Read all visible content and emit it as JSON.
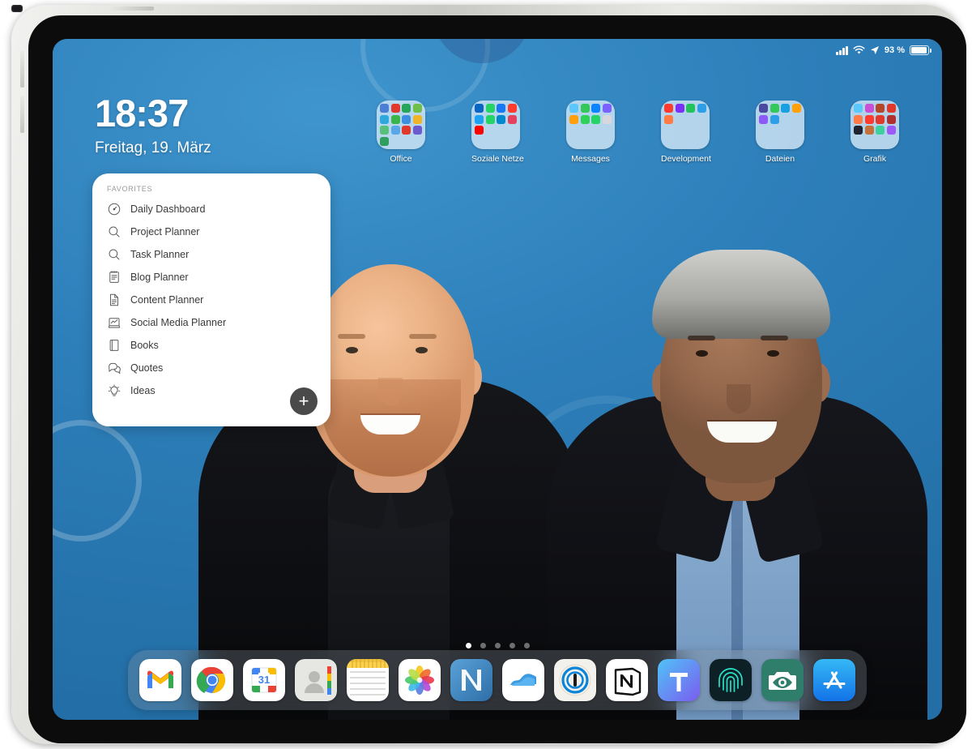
{
  "device": {
    "name": "iPad Pro"
  },
  "status_bar": {
    "signal_icon": "cellular-signal-icon",
    "wifi_icon": "wifi-icon",
    "location_icon": "location-arrow-icon",
    "battery_percent": "93 %",
    "battery_icon": "battery-icon"
  },
  "clock": {
    "time": "18:37",
    "date": "Freitag, 19. März"
  },
  "folders": [
    {
      "label": "Office",
      "count": 13
    },
    {
      "label": "Soziale Netze",
      "count": 9
    },
    {
      "label": "Messages",
      "count": 8
    },
    {
      "label": "Development",
      "count": 5
    },
    {
      "label": "Dateien",
      "count": 6
    },
    {
      "label": "Grafik",
      "count": 12
    }
  ],
  "favorites_widget": {
    "title": "FAVORITES",
    "add_button_label": "+",
    "items": [
      {
        "label": "Daily Dashboard",
        "icon": "gauge-icon"
      },
      {
        "label": "Project Planner",
        "icon": "magnifier-icon"
      },
      {
        "label": "Task Planner",
        "icon": "magnifier-icon"
      },
      {
        "label": "Blog Planner",
        "icon": "notepad-icon"
      },
      {
        "label": "Content Planner",
        "icon": "document-icon"
      },
      {
        "label": "Social Media Planner",
        "icon": "chart-board-icon"
      },
      {
        "label": "Books",
        "icon": "book-icon"
      },
      {
        "label": "Quotes",
        "icon": "speech-bubbles-icon"
      },
      {
        "label": "Ideas",
        "icon": "lightbulb-icon"
      }
    ]
  },
  "page_dots": {
    "total": 5,
    "active_index": 0
  },
  "dock": {
    "apps": [
      {
        "name": "Gmail",
        "icon": "gmail-icon"
      },
      {
        "name": "Chrome",
        "icon": "chrome-icon"
      },
      {
        "name": "Google Calendar",
        "icon": "google-calendar-icon",
        "day": "31"
      },
      {
        "name": "Google Contacts",
        "icon": "contacts-icon"
      },
      {
        "name": "Notes",
        "icon": "notes-icon"
      },
      {
        "name": "Photos",
        "icon": "photos-icon"
      },
      {
        "name": "Notability",
        "icon": "notability-icon"
      },
      {
        "name": "MindNode",
        "icon": "mindnode-icon"
      },
      {
        "name": "1Password",
        "icon": "onepassword-icon"
      },
      {
        "name": "Notion",
        "icon": "notion-icon"
      },
      {
        "name": "Textastic",
        "icon": "textastic-icon"
      },
      {
        "name": "Touch ID App",
        "icon": "fingerprint-icon"
      },
      {
        "name": "Halide",
        "icon": "camera-eye-icon"
      },
      {
        "name": "App Store",
        "icon": "app-store-icon"
      }
    ]
  },
  "wallpaper": {
    "description": "Photo of two smiling men in dark jackets against a blue backdrop",
    "background_color": "#2d7fba"
  },
  "folder_mini_colors": {
    "office": [
      "#4a7fd4",
      "#e0392b",
      "#27a65b",
      "#6fbf4a",
      "#2fa8dd",
      "#39b54a",
      "#3f8fe0",
      "#f0b429",
      "#58c07a",
      "#5aa7e8",
      "#e0392b",
      "#6a5acd",
      "#2f9e5e"
    ],
    "soziale": [
      "#0a66c2",
      "#25d366",
      "#1877f2",
      "#ff3b30",
      "#1da1f2",
      "#25d366",
      "#0088cc",
      "#e4405f",
      "#ff0000"
    ],
    "messages": [
      "#5ac8fa",
      "#34c759",
      "#0a84ff",
      "#7b61ff",
      "#ff9f0a",
      "#30d158",
      "#25d366",
      "#d8d8dc"
    ],
    "development": [
      "#ff3b30",
      "#7b2ff7",
      "#24c25a",
      "#2f9ee8",
      "#ff7a45"
    ],
    "dateien": [
      "#4a4a9e",
      "#34c759",
      "#1a9fe0",
      "#ff9f0a",
      "#8e5af7",
      "#2f9ee8"
    ],
    "grafik": [
      "#5ac8fa",
      "#c94fd4",
      "#b4472a",
      "#e0392b",
      "#ff7a45",
      "#ff3b30",
      "#e0392b",
      "#b03030",
      "#1f2430",
      "#c4703a",
      "#3fcf9e",
      "#9b5af7"
    ]
  }
}
